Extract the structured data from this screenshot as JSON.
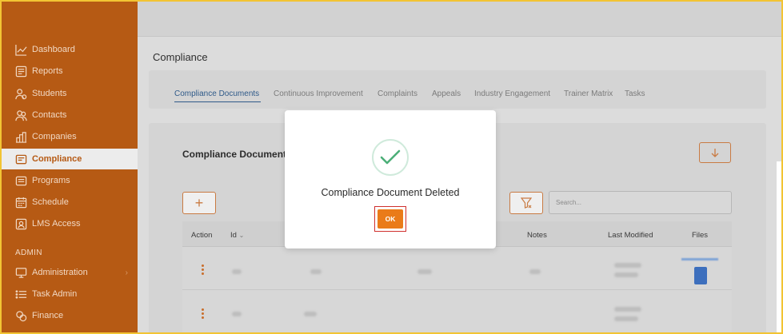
{
  "sidebar": {
    "items": [
      {
        "label": "Dashboard",
        "icon": "chart-line-icon"
      },
      {
        "label": "Reports",
        "icon": "report-icon"
      },
      {
        "label": "Students",
        "icon": "students-icon"
      },
      {
        "label": "Contacts",
        "icon": "contacts-icon"
      },
      {
        "label": "Companies",
        "icon": "companies-icon"
      },
      {
        "label": "Compliance",
        "icon": "compliance-icon",
        "active": true
      },
      {
        "label": "Programs",
        "icon": "programs-icon"
      },
      {
        "label": "Schedule",
        "icon": "calendar-icon"
      },
      {
        "label": "LMS Access",
        "icon": "lms-icon"
      }
    ],
    "admin_section": "ADMIN",
    "admin_items": [
      {
        "label": "Administration",
        "icon": "monitor-icon"
      },
      {
        "label": "Task Admin",
        "icon": "list-icon"
      },
      {
        "label": "Finance",
        "icon": "coins-icon"
      }
    ]
  },
  "page": {
    "title": "Compliance",
    "tabs": [
      "Compliance Documents",
      "Continuous Improvement",
      "Complaints",
      "Appeals",
      "Industry Engagement",
      "Trainer Matrix",
      "Tasks"
    ],
    "active_tab": "Compliance Documents"
  },
  "section": {
    "title": "Compliance Documents",
    "add_label": "+",
    "search_placeholder": "Search..."
  },
  "table": {
    "columns": [
      "Action",
      "Id",
      "Notes",
      "Last Modified",
      "Files"
    ]
  },
  "modal": {
    "message": "Compliance Document Deleted",
    "ok_label": "OK"
  },
  "colors": {
    "sidebar": "#b65a14",
    "accent": "#ea7b19",
    "success": "#4caf78",
    "tab_active": "#2f5a89"
  }
}
